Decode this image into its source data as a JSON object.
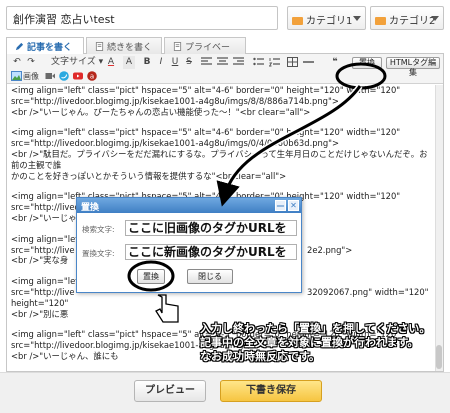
{
  "header": {
    "title_value": "創作演習 恋占いtest",
    "category1": "カテゴリ1",
    "category2": "カテゴリ2"
  },
  "tabs": [
    {
      "label": "記事を書く",
      "active": true
    },
    {
      "label": "続きを書く",
      "active": false
    },
    {
      "label": "プライベート",
      "active": false
    }
  ],
  "toolbar": {
    "undo": "↶",
    "redo": "↷",
    "font_size": "文字サイズ",
    "text_color": "A",
    "bg_color": "A",
    "bold": "B",
    "italic": "I",
    "underline": "U",
    "strike": "S",
    "quote": "❝",
    "replace_label": "置換",
    "html_label": "HTMLタグ編集",
    "image_label": "画像"
  },
  "content": {
    "lines": [
      "<img  align=\"left\" class=\"pict\" hspace=\"5\" alt=\"4-6\" border=\"0\" height=\"120\" width=\"120\"",
      "src=\"http://livedoor.blogimg.jp/kisekae1001-a4g8u/imgs/8/8/886a714b.png\">",
      "<br />\"いーじゃん。ぴーたちゃんの恋占い機能使った～！\"<br  clear=\"all\">",
      "<img  align=\"left\" class=\"pict\" hspace=\"5\" alt=\"4-6\" border=\"0\" height=\"120\" width=\"120\"",
      "src=\"http://livedoor.blogimg.jp/kisekae1001-a4g8u/imgs/0/4/0460b63d.png\">",
      "<br />\"駄目だ。プライバシーをだだ漏れにするな。プライバシーって生年月日のことだけじゃないんだぞ。お前の主観で誰",
      "かのことを好きっぽいとかそういう情報を提供するな\"<br  clear=\"all\">",
      "<img  align=\"left\" class=\"pict\" hspace=\"5\" alt=\"4-6\" border=\"0\" height=\"120\" width=\"120\"",
      "src=\"http://livedoor.blogimg.jp/kisekae1001-a4g8u/imgs/",
      "<br />\"いーじゃ",
      "<img  align=\"left\" class=\"pict\" hspace=\"5\"",
      "src=\"http://live",
      "<br />\"実な身",
      "<img  align=\"left\" class=\"pict\" hspace=\"5\"",
      "src=\"http://live",
      "height=\"120\"",
      "<br />\"別に悪",
      "<img  align=\"left\" class=\"pict\" hspace=\"5\" alt=\"4-3\" border=\"0\" height=\"120\" width=\"120\"",
      "src=\"http://livedoor.blogimg.jp/kisekae1001-a4g8u/imgs/",
      "<br />\"いーじゃん、誰にも"
    ],
    "partial_right": [
      "2e2.png\">",
      "32092067.png\" width=\"120\""
    ]
  },
  "dialog": {
    "title": "置換",
    "search_label": "検索文字:",
    "search_value": "ここに旧画像のタグかURLを",
    "replace_label": "置換文字:",
    "replace_value": "ここに新画像のタグかURLを",
    "replace_button": "置換",
    "close_button": "閉じる",
    "min_glyph": "—",
    "close_glyph": "✕"
  },
  "footer": {
    "preview": "プレビュー",
    "save_draft": "下書き保存"
  },
  "callout": {
    "line1": "入力し終わったら「置換」を押してください。",
    "line2": "記事中の全文章を対象に置換が行われます。",
    "line3": "なお成功時無反応です。"
  },
  "colors": {
    "accent": "#2a6db0",
    "dialog_title": "#3f7fc4",
    "save": "#f6c541"
  }
}
